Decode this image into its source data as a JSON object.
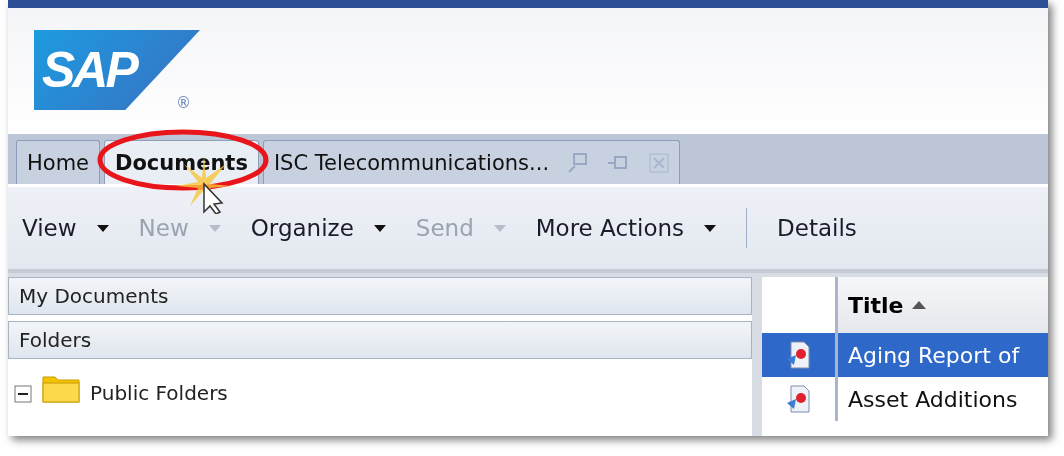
{
  "logo": {
    "text": "SAP",
    "mark": "®"
  },
  "tabs": [
    {
      "label": "Home",
      "selected": false,
      "kind": "plain"
    },
    {
      "label": "Documents",
      "selected": true,
      "kind": "plain"
    },
    {
      "label": "ISC Telecommunications...",
      "selected": false,
      "kind": "document"
    }
  ],
  "toolbar": [
    {
      "label": "View",
      "disabled": false,
      "dropdown": true
    },
    {
      "label": "New",
      "disabled": true,
      "dropdown": true
    },
    {
      "label": "Organize",
      "disabled": false,
      "dropdown": true
    },
    {
      "label": "Send",
      "disabled": true,
      "dropdown": true
    },
    {
      "label": "More Actions",
      "disabled": false,
      "dropdown": true,
      "separator_after": true
    },
    {
      "label": "Details",
      "disabled": false,
      "dropdown": false
    }
  ],
  "panels": [
    {
      "title": "My Documents"
    },
    {
      "title": "Folders"
    }
  ],
  "tree": [
    {
      "label": "Public Folders",
      "expanded": true
    }
  ],
  "table": {
    "columns": [
      {
        "label": "Title",
        "sorted": true
      }
    ],
    "rows": [
      {
        "title": "Aging Report of",
        "selected": true
      },
      {
        "title": "Asset Additions",
        "selected": false
      }
    ]
  }
}
